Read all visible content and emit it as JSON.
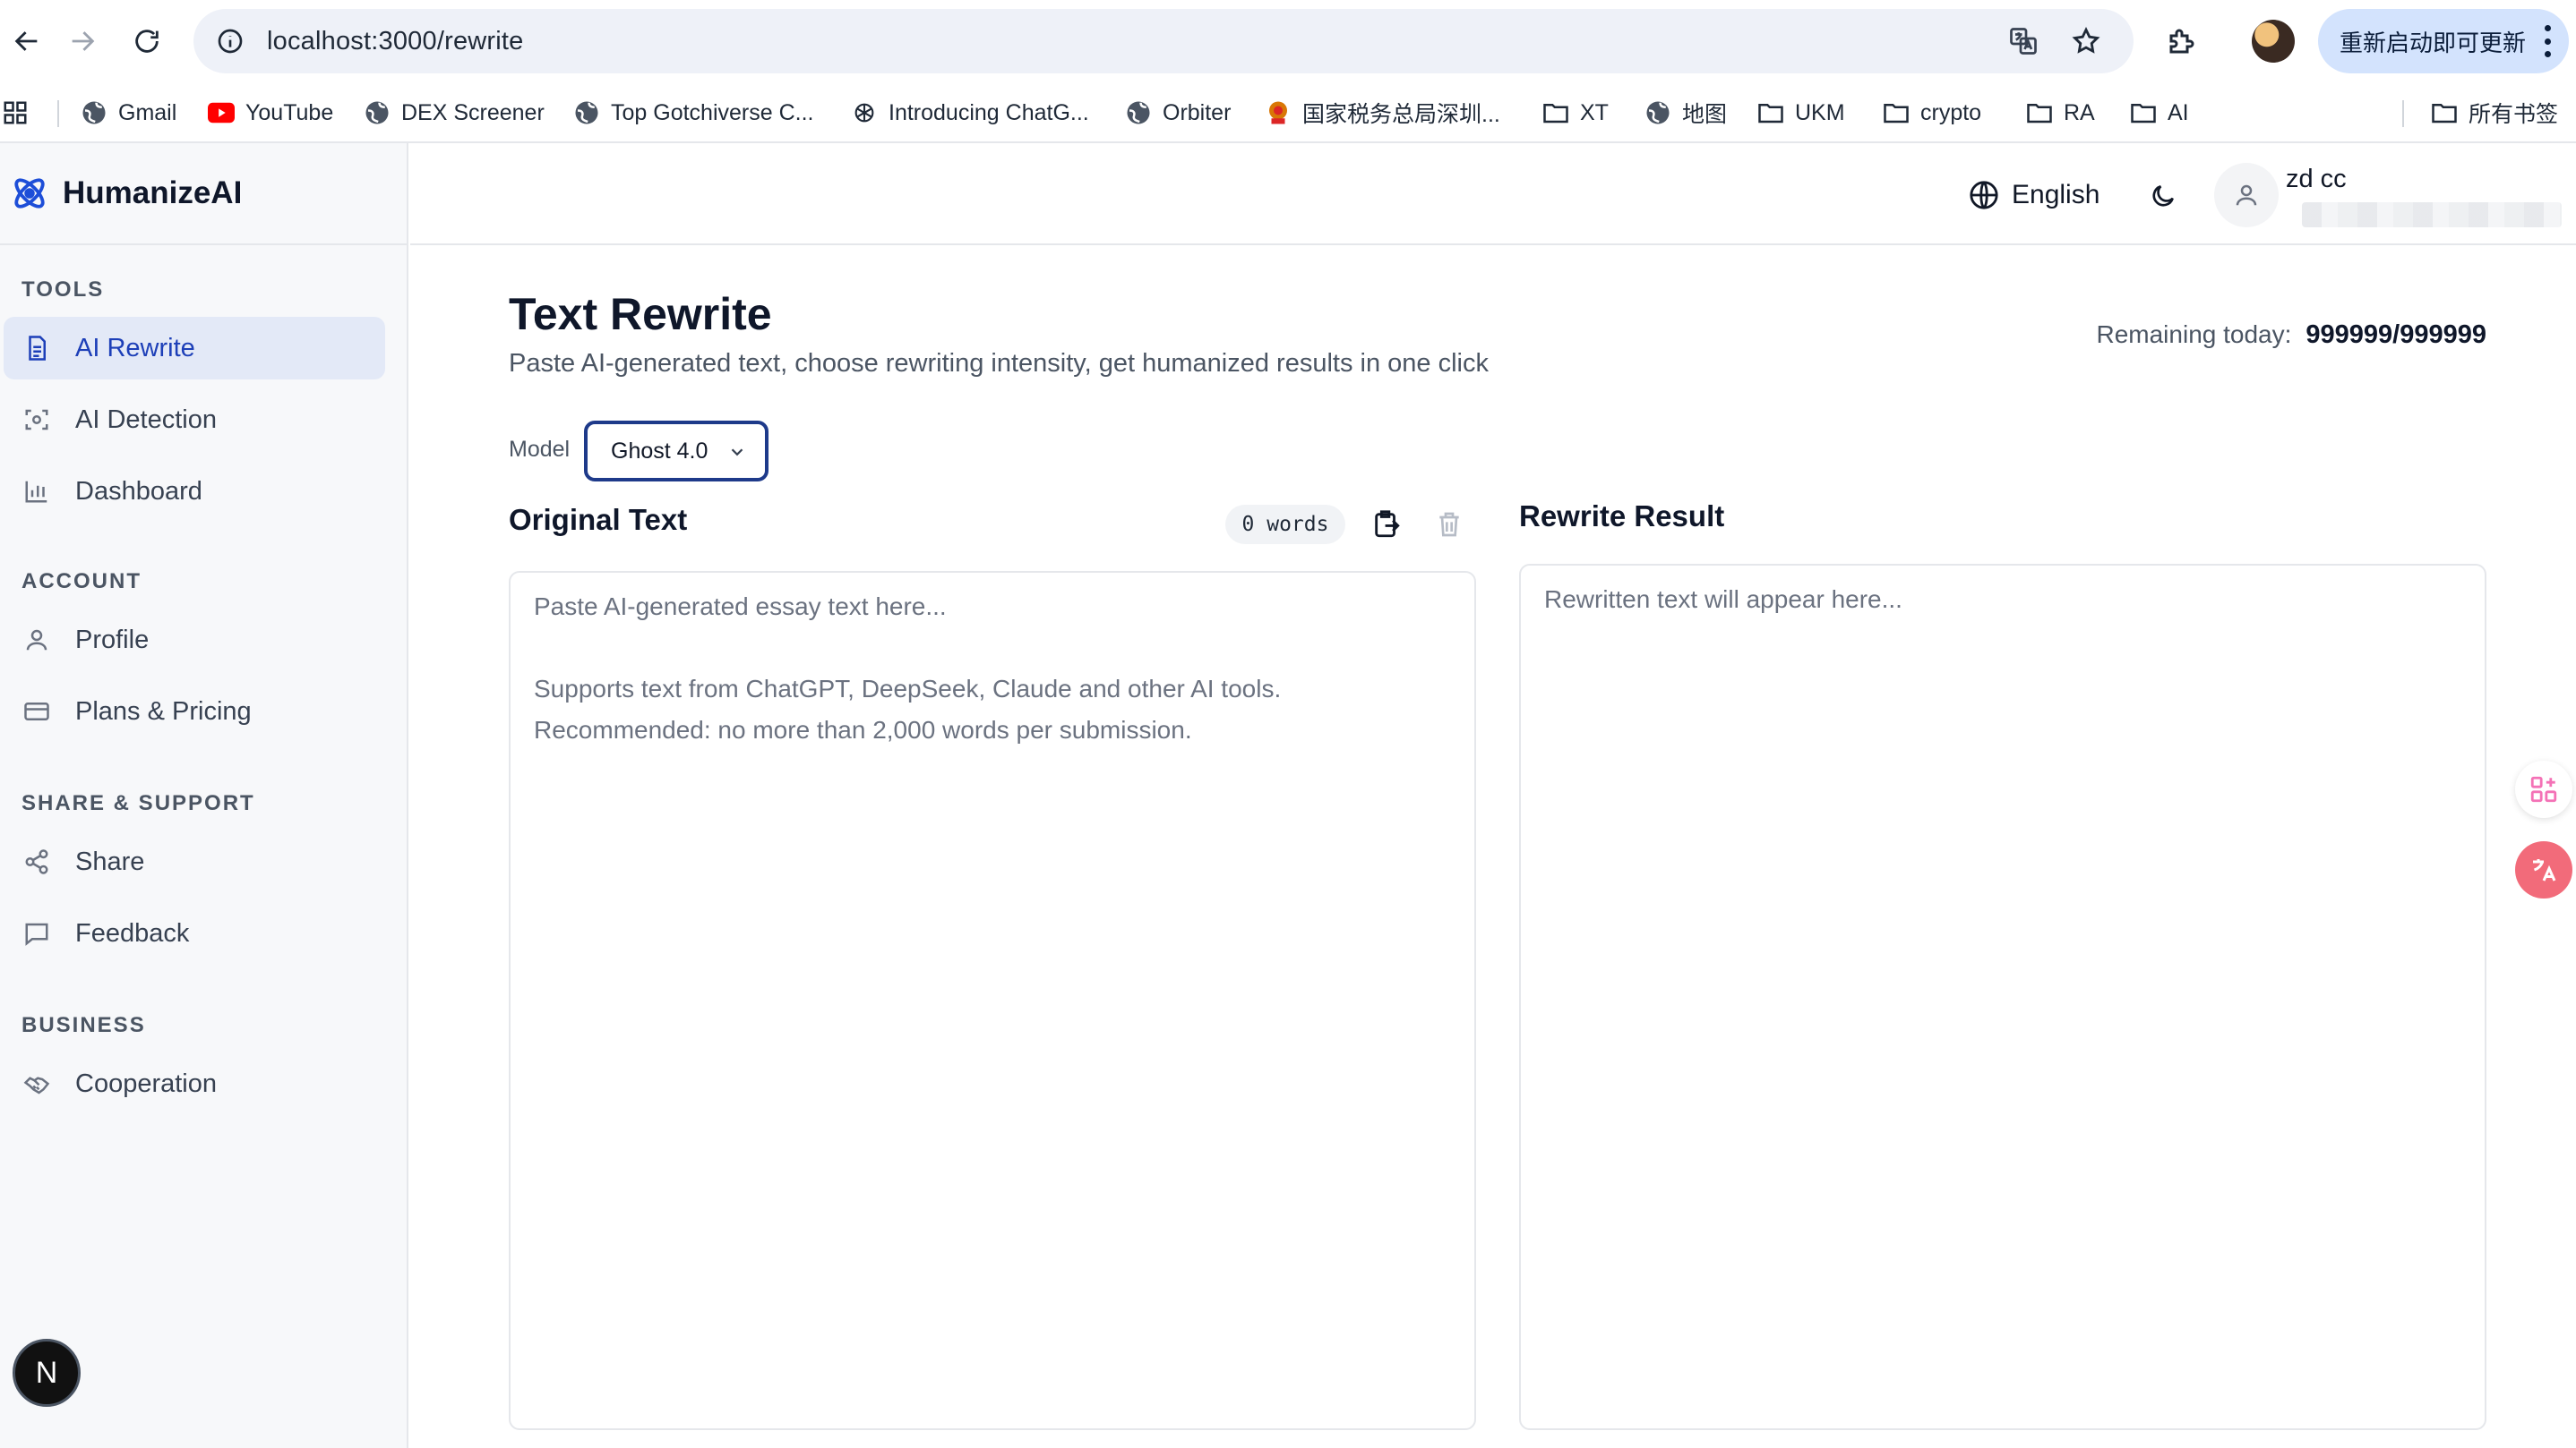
{
  "browser": {
    "url": "localhost:3000/rewrite",
    "update_label": "重新启动即可更新",
    "bookmarks": [
      {
        "label": "Gmail",
        "icon": "globe-icon"
      },
      {
        "label": "YouTube",
        "icon": "youtube-icon"
      },
      {
        "label": "DEX Screener",
        "icon": "globe-icon"
      },
      {
        "label": "Top Gotchiverse C...",
        "icon": "globe-icon"
      },
      {
        "label": "Introducing ChatG...",
        "icon": "openai-icon"
      },
      {
        "label": "Orbiter",
        "icon": "globe-icon"
      },
      {
        "label": "国家税务总局深圳...",
        "icon": "tax-emblem-icon"
      },
      {
        "label": "XT",
        "icon": "folder-icon"
      },
      {
        "label": "地图",
        "icon": "globe-icon"
      },
      {
        "label": "UKM",
        "icon": "folder-icon"
      },
      {
        "label": "crypto",
        "icon": "folder-icon"
      },
      {
        "label": "RA",
        "icon": "folder-icon"
      },
      {
        "label": "AI",
        "icon": "folder-icon"
      }
    ],
    "all_bookmarks_label": "所有书签"
  },
  "brand": {
    "name": "HumanizeAI",
    "color": "#1d4ed8"
  },
  "sidebar": {
    "sections": [
      {
        "title": "TOOLS",
        "items": [
          {
            "label": "AI Rewrite",
            "icon": "document-icon",
            "active": true
          },
          {
            "label": "AI Detection",
            "icon": "scan-icon"
          },
          {
            "label": "Dashboard",
            "icon": "bar-chart-icon"
          }
        ]
      },
      {
        "title": "ACCOUNT",
        "items": [
          {
            "label": "Profile",
            "icon": "user-icon"
          },
          {
            "label": "Plans & Pricing",
            "icon": "credit-card-icon"
          }
        ]
      },
      {
        "title": "SHARE & SUPPORT",
        "items": [
          {
            "label": "Share",
            "icon": "share-icon"
          },
          {
            "label": "Feedback",
            "icon": "message-icon"
          }
        ]
      },
      {
        "title": "BUSINESS",
        "items": [
          {
            "label": "Cooperation",
            "icon": "handshake-icon"
          }
        ]
      }
    ],
    "badge": "N"
  },
  "header": {
    "language": "English",
    "user_name": "zd cc"
  },
  "main": {
    "title": "Text Rewrite",
    "subtitle": "Paste AI-generated text, choose rewriting intensity, get humanized results in one click",
    "remaining_label": "Remaining today:",
    "remaining_value": "999999/999999",
    "model_label": "Model",
    "model_value": "Ghost 4.0",
    "original": {
      "title": "Original Text",
      "word_count": "0 words",
      "placeholder_line1": "Paste AI-generated essay text here...",
      "placeholder_line2": "Supports text from ChatGPT, DeepSeek, Claude and other AI tools.",
      "placeholder_line3": "Recommended: no more than 2,000 words per submission."
    },
    "result": {
      "title": "Rewrite Result",
      "placeholder": "Rewritten text will appear here..."
    }
  }
}
